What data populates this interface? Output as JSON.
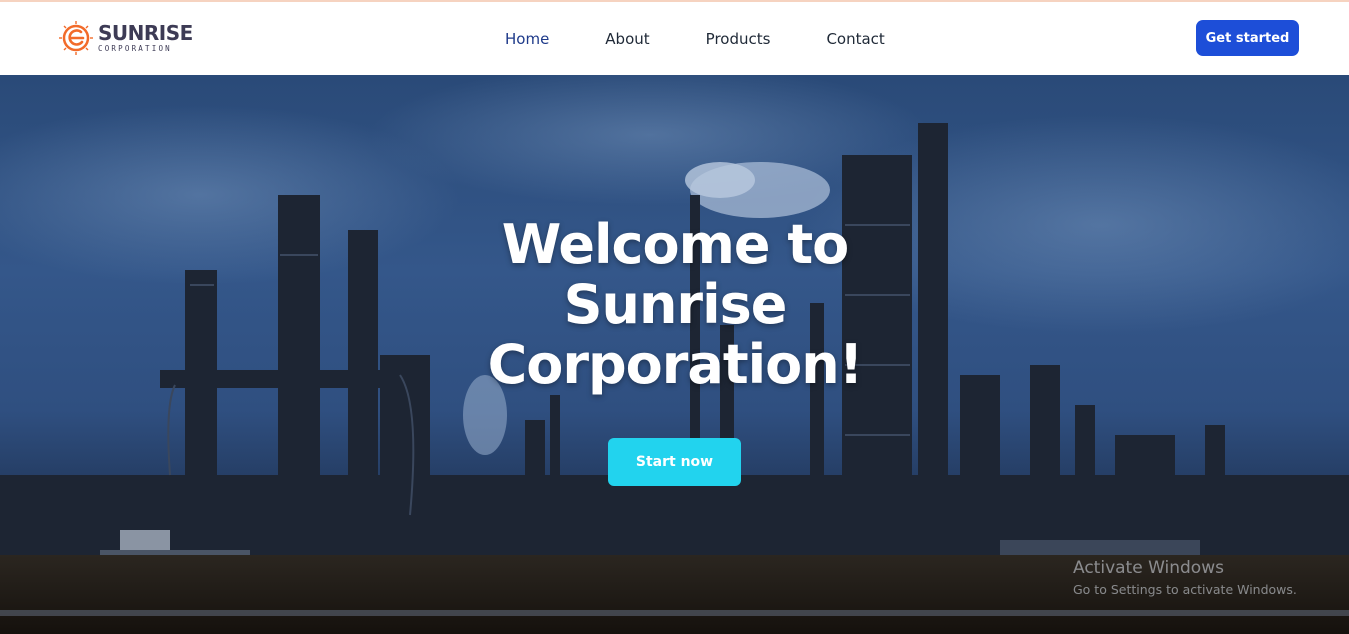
{
  "brand": {
    "name": "SUNRISE",
    "tagline": "CORPORATION",
    "accent": "#f26b2a",
    "text_color": "#3d3b55"
  },
  "nav": {
    "items": [
      {
        "label": "Home",
        "active": true
      },
      {
        "label": "About",
        "active": false
      },
      {
        "label": "Products",
        "active": false
      },
      {
        "label": "Contact",
        "active": false
      }
    ],
    "cta_label": "Get started",
    "cta_color": "#1d4ed8"
  },
  "hero": {
    "title": "Welcome to Sunrise Corporation!",
    "cta_label": "Start now",
    "cta_color": "#22d3ee",
    "background": "industrial-refinery-photo"
  },
  "watermark": {
    "title": "Activate Windows",
    "subtitle": "Go to Settings to activate Windows."
  }
}
